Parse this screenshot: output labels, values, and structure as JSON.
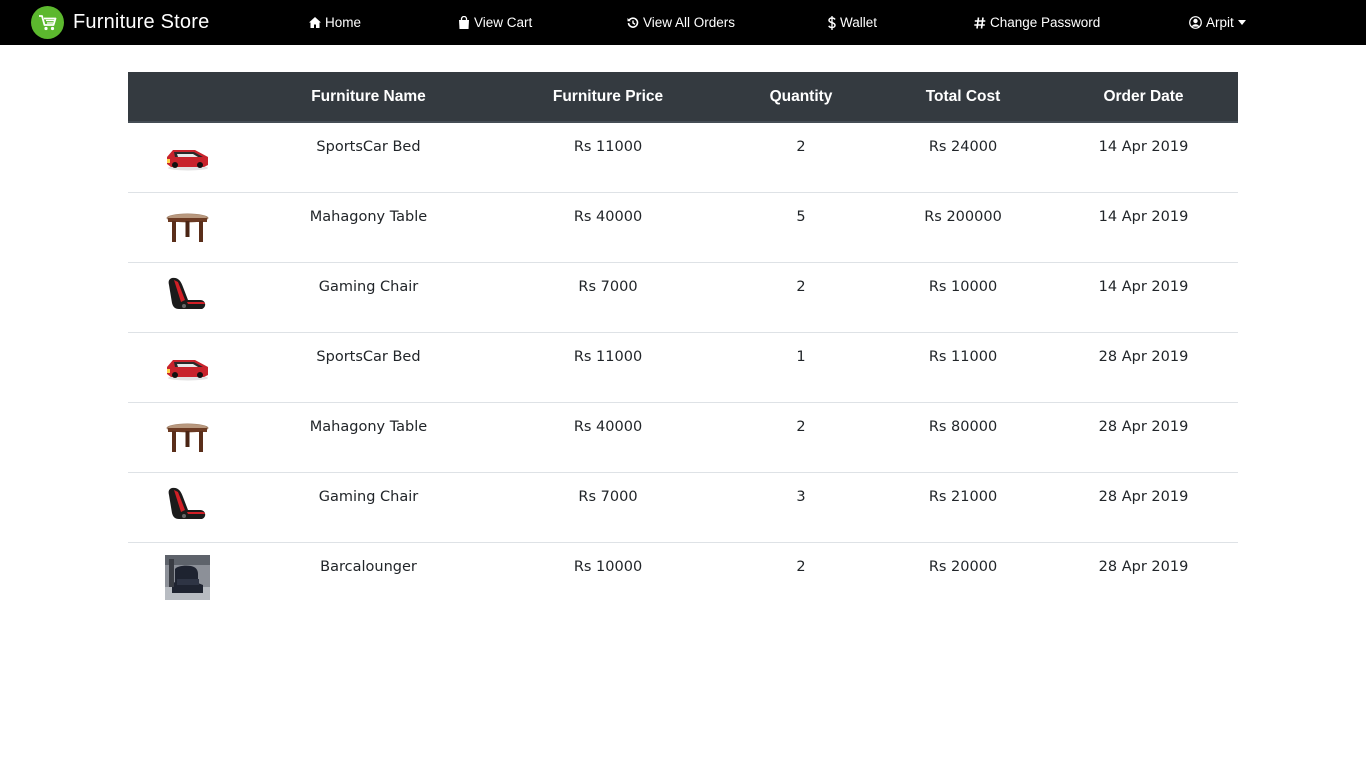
{
  "nav": {
    "brand": "Furniture Store",
    "home": "Home",
    "view_cart": "View Cart",
    "view_all_orders": "View All Orders",
    "wallet": "Wallet",
    "change_password": "Change Password",
    "user": "Arpit"
  },
  "colors": {
    "navbar": "#000000",
    "logo": "#5cb82e",
    "table_header": "#343a40"
  },
  "table": {
    "headers": [
      "",
      "Furniture Name",
      "Furniture Price",
      "Quantity",
      "Total Cost",
      "Order Date"
    ],
    "rows": [
      {
        "image": "sportscar-bed",
        "name": "SportsCar Bed",
        "price": "Rs 11000",
        "qty": "2",
        "total": "Rs 24000",
        "date": "14 Apr 2019"
      },
      {
        "image": "mahagony-table",
        "name": "Mahagony Table",
        "price": "Rs 40000",
        "qty": "5",
        "total": "Rs 200000",
        "date": "14 Apr 2019"
      },
      {
        "image": "gaming-chair",
        "name": "Gaming Chair",
        "price": "Rs 7000",
        "qty": "2",
        "total": "Rs 10000",
        "date": "14 Apr 2019"
      },
      {
        "image": "sportscar-bed",
        "name": "SportsCar Bed",
        "price": "Rs 11000",
        "qty": "1",
        "total": "Rs 11000",
        "date": "28 Apr 2019"
      },
      {
        "image": "mahagony-table",
        "name": "Mahagony Table",
        "price": "Rs 40000",
        "qty": "2",
        "total": "Rs 80000",
        "date": "28 Apr 2019"
      },
      {
        "image": "gaming-chair",
        "name": "Gaming Chair",
        "price": "Rs 7000",
        "qty": "3",
        "total": "Rs 21000",
        "date": "28 Apr 2019"
      },
      {
        "image": "barcalounger",
        "name": "Barcalounger",
        "price": "Rs 10000",
        "qty": "2",
        "total": "Rs 20000",
        "date": "28 Apr 2019"
      }
    ]
  }
}
